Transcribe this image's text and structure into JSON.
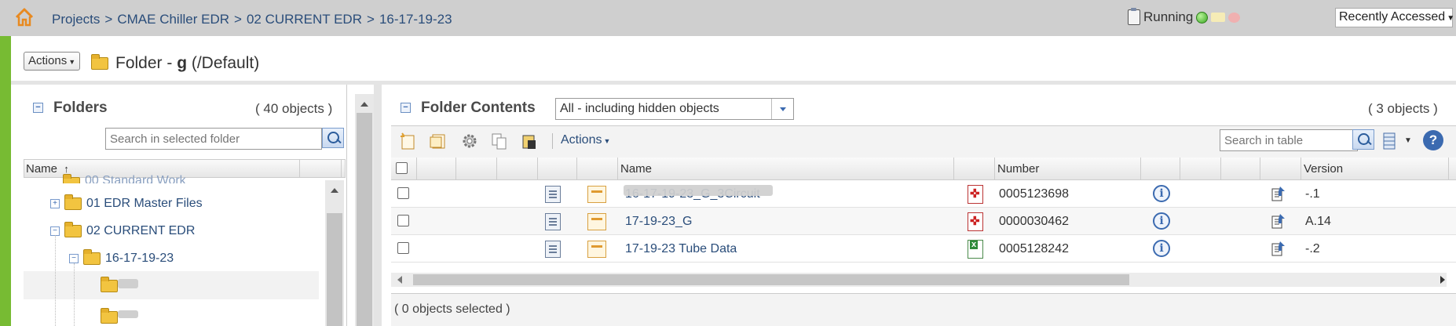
{
  "breadcrumb": {
    "items": [
      "Projects",
      "CMAE Chiller EDR",
      "02 CURRENT EDR",
      "16-17-19-23"
    ],
    "separator": ">"
  },
  "status": {
    "label": "Running"
  },
  "recent": {
    "label": "Recently Accessed"
  },
  "header": {
    "actions_label": "Actions",
    "title_prefix": "Folder - ",
    "title_bold": "g",
    "title_suffix": " (/Default)"
  },
  "folders": {
    "title": "Folders",
    "count": "( 40 objects )",
    "search_placeholder": "Search in selected folder",
    "column_name": "Name",
    "tree": [
      {
        "label": "00 Standard Work",
        "toggle": ""
      },
      {
        "label": "01 EDR Master Files",
        "toggle": "+"
      },
      {
        "label": "02 CURRENT EDR",
        "toggle": "−"
      },
      {
        "label": "16-17-19-23",
        "toggle": "−"
      }
    ]
  },
  "contents": {
    "title": "Folder Contents",
    "filter": "All - including hidden objects",
    "count": "( 3 objects )",
    "toolbar_actions": "Actions",
    "search_placeholder": "Search in table",
    "columns": {
      "name": "Name",
      "number": "Number",
      "version": "Version"
    },
    "rows": [
      {
        "name": "16-17-19-23_G_3Circuit",
        "number": "0005123698",
        "version": "-.1",
        "type": "pdf"
      },
      {
        "name": "17-19-23_G",
        "number": "0000030462",
        "version": "A.14",
        "type": "pdf"
      },
      {
        "name": "17-19-23 Tube Data",
        "number": "0005128242",
        "version": "-.2",
        "type": "xls"
      }
    ],
    "footer": "( 0 objects selected )"
  },
  "colors": {
    "accent": "#2a4d7a",
    "leftbar": "#77bb33"
  }
}
